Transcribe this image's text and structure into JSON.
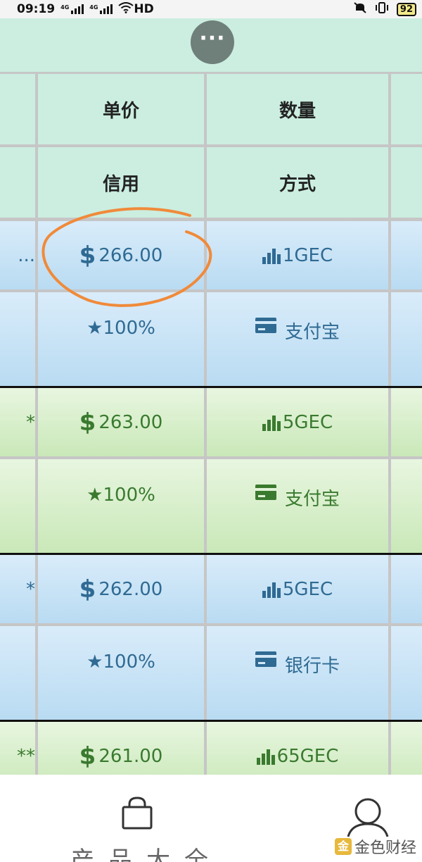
{
  "status_bar": {
    "time": "09:19",
    "network_1": "4G",
    "network_2": "4G",
    "hd": "HD",
    "battery": "92"
  },
  "header": {
    "more_label": "···"
  },
  "table": {
    "headers_row1": [
      "",
      "单价",
      "数量",
      ""
    ],
    "headers_row2": [
      "",
      "信用",
      "方式",
      ""
    ],
    "offers": [
      {
        "theme": "blue",
        "left_fragment": "...",
        "price_symbol": "$",
        "price": "266.00",
        "amount": "1GEC",
        "credit": "★100%",
        "method": "支付宝"
      },
      {
        "theme": "green",
        "left_fragment": "*",
        "price_symbol": "$",
        "price": "263.00",
        "amount": "5GEC",
        "credit": "★100%",
        "method": "支付宝"
      },
      {
        "theme": "blue",
        "left_fragment": "*",
        "price_symbol": "$",
        "price": "262.00",
        "amount": "5GEC",
        "credit": "★100%",
        "method": "银行卡"
      },
      {
        "theme": "green",
        "left_fragment": "**",
        "price_symbol": "$",
        "price": "261.00",
        "amount": "65GEC"
      }
    ]
  },
  "annotation": {
    "color": "#f08a3a"
  },
  "bottom_nav": {
    "partial_text": "产品大全",
    "watermark": "金色财经",
    "watermark_badge": "金"
  }
}
